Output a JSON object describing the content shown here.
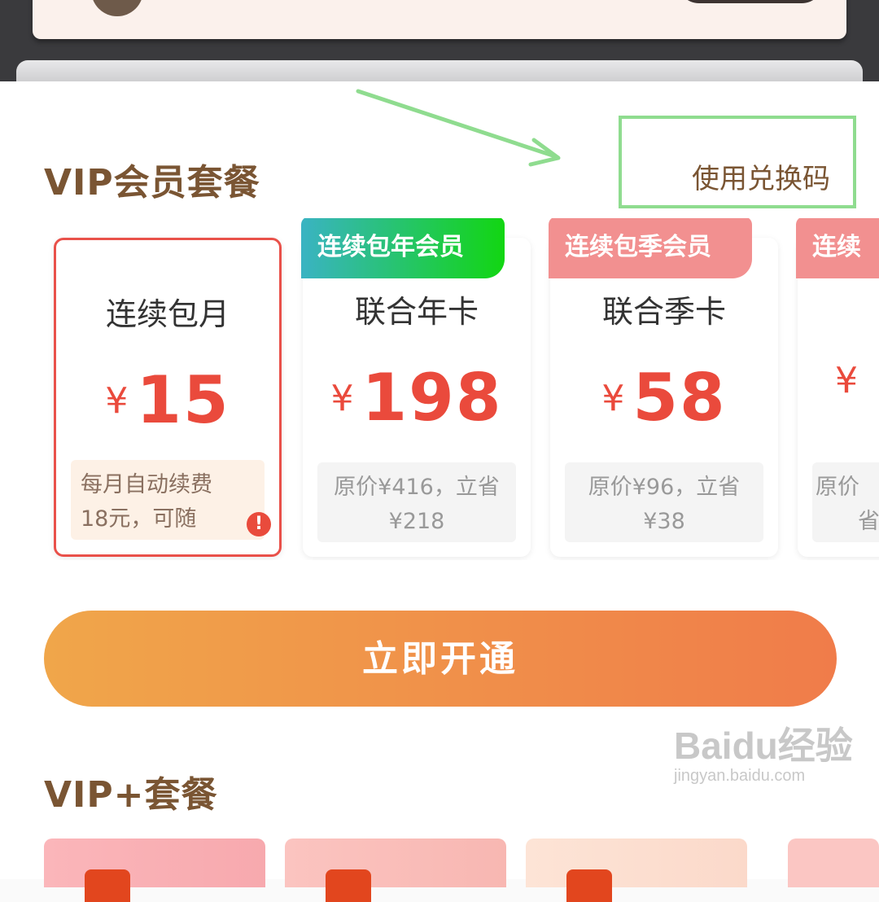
{
  "vip_section": {
    "title": "VIP会员套餐",
    "redeem_link": "使用兑换码"
  },
  "packages": [
    {
      "badge": "",
      "name": "连续包月",
      "price_symbol": "¥",
      "price": "15",
      "note_line1": "每月自动续费",
      "note_line2": "18元，可随",
      "selected": true
    },
    {
      "badge": "连续包年会员",
      "name": "联合年卡",
      "price_symbol": "¥",
      "price": "198",
      "note_line1": "原价¥416，立省",
      "note_line2": "¥218"
    },
    {
      "badge": "连续包季会员",
      "name": "联合季卡",
      "price_symbol": "¥",
      "price": "58",
      "note_line1": "原价¥96，立省",
      "note_line2": "¥38"
    },
    {
      "badge": "连续",
      "name": "",
      "price_symbol": "¥",
      "price": "",
      "note_line1": "原价",
      "note_line2": "省"
    }
  ],
  "open_button": "立即开通",
  "vip_plus_section": {
    "title": "VIP+套餐"
  },
  "colors": {
    "accent_brown": "#7a5533",
    "price_red": "#ea4a3c",
    "button_gradient_start": "#f0a64a",
    "button_gradient_end": "#f07c4a",
    "highlight_green": "#8fdc8f"
  },
  "watermark": {
    "main": "Baidu经验",
    "sub": "jingyan.baidu.com"
  }
}
